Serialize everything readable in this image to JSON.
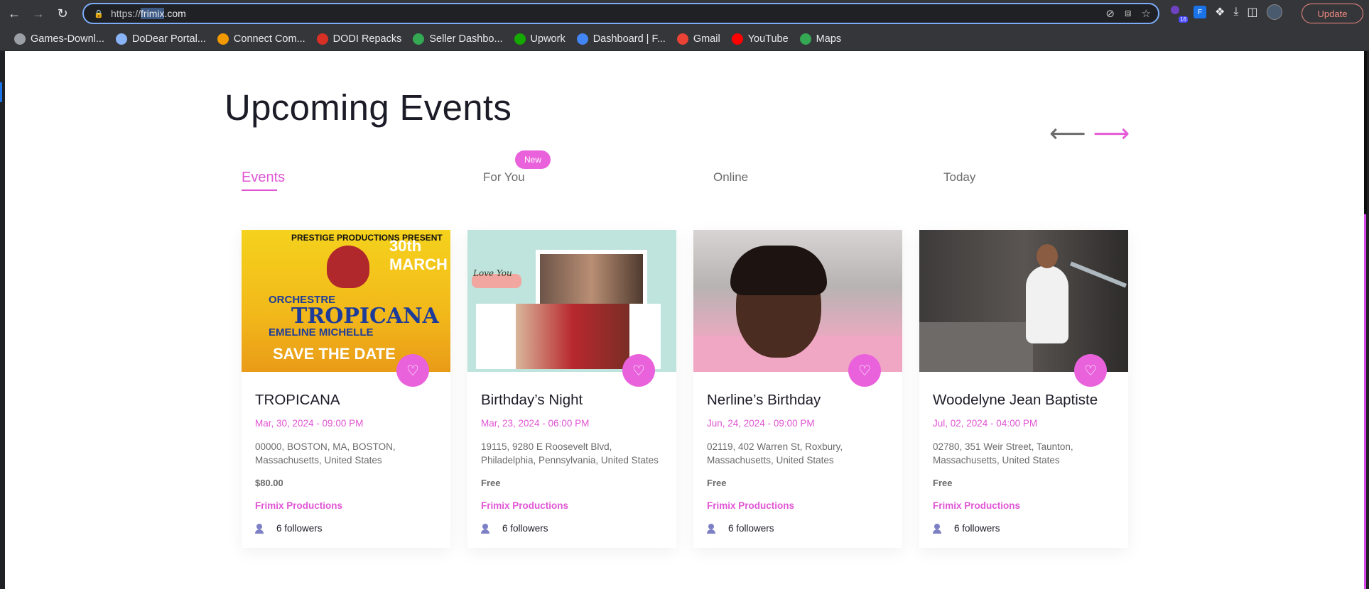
{
  "browser": {
    "url_scheme": "https://",
    "url_host_highlight": "frimix",
    "url_rest": ".com",
    "update_label": "Update",
    "extension_badge": "16",
    "extension_letter": "F",
    "bookmarks": [
      {
        "label": "Games-Downl...",
        "color": "#9aa0a6"
      },
      {
        "label": "DoDear Portal...",
        "color": "#8ab4f8"
      },
      {
        "label": "Connect Com...",
        "color": "#f29900"
      },
      {
        "label": "DODI Repacks",
        "color": "#d93025"
      },
      {
        "label": "Seller Dashbo...",
        "color": "#34a853"
      },
      {
        "label": "Upwork",
        "color": "#14a800"
      },
      {
        "label": "Dashboard | F...",
        "color": "#4285f4"
      },
      {
        "label": "Gmail",
        "color": "#ea4335"
      },
      {
        "label": "YouTube",
        "color": "#ff0000"
      },
      {
        "label": "Maps",
        "color": "#34a853"
      }
    ]
  },
  "page": {
    "title": "Upcoming Events",
    "tabs": {
      "events": "Events",
      "for_you": "For You",
      "new_badge": "New",
      "online": "Online",
      "today": "Today"
    },
    "events": [
      {
        "name": "TROPICANA",
        "date": "Mar, 30, 2024 - 09:00 PM",
        "address": "00000, BOSTON, MA, BOSTON, Massachusetts, United States",
        "price": "$80.00",
        "organizer": "Frimix Productions",
        "followers": "6 followers",
        "flyer": {
          "top": "PRESTIGE PRODUCTIONS PRESENT",
          "date": "30th MARCH",
          "sub": "ORCHESTRE",
          "band": "TROPICANA",
          "guest": "EMELINE MICHELLE",
          "cta": "SAVE THE DATE"
        }
      },
      {
        "name": "Birthday’s Night",
        "date": "Mar, 23, 2024 - 06:00 PM",
        "address": "19115, 9280 E Roosevelt Blvd, Philadelphia, Pennsylvania, United States",
        "price": "Free",
        "organizer": "Frimix Productions",
        "followers": "6 followers",
        "flyer": {
          "caption": "Love You"
        }
      },
      {
        "name": "Nerline’s Birthday",
        "date": "Jun, 24, 2024 - 09:00 PM",
        "address": "02119, 402 Warren St, Roxbury, Massachusetts, United States",
        "price": "Free",
        "organizer": "Frimix Productions",
        "followers": "6 followers"
      },
      {
        "name": "Woodelyne Jean Baptiste",
        "date": "Jul, 02, 2024 - 04:00 PM",
        "address": "02780, 351 Weir Street, Taunton, Massachusetts, United States",
        "price": "Free",
        "organizer": "Frimix Productions",
        "followers": "6 followers"
      }
    ]
  },
  "colors": {
    "accent": "#e055d4",
    "heart_bg": "#e962dc",
    "text_dark": "#1c1c28",
    "text_muted": "#6b6b6b"
  }
}
